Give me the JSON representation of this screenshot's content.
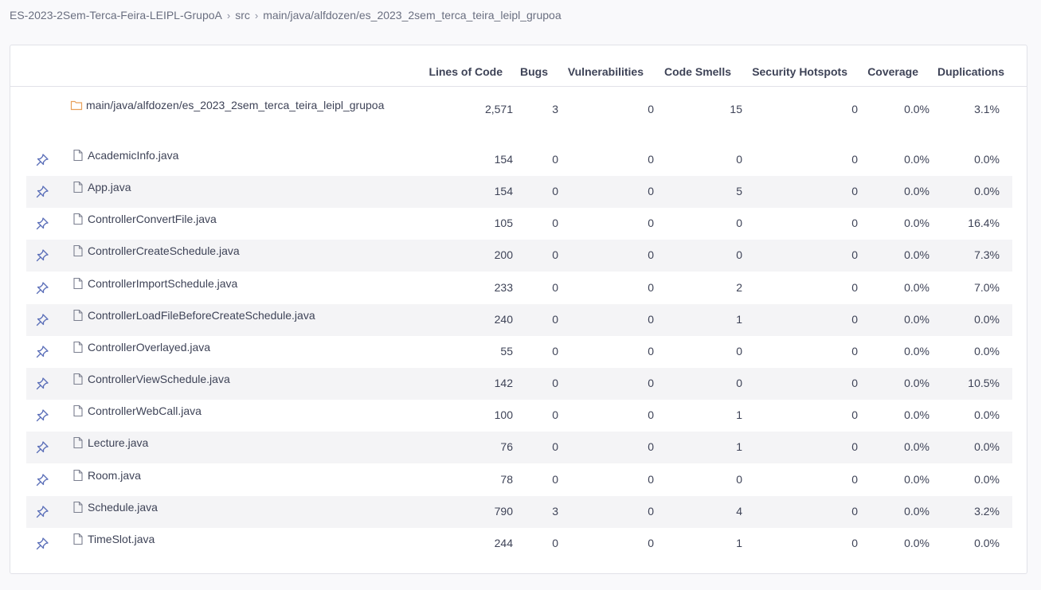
{
  "breadcrumb": {
    "project": "ES-2023-2Sem-Terca-Feira-LEIPL-GrupoA",
    "src": "src",
    "path": "main/java/alfdozen/es_2023_2sem_terca_teira_leipl_grupoa"
  },
  "columns": {
    "loc": "Lines of Code",
    "bugs": "Bugs",
    "vulnerabilities": "Vulnerabilities",
    "code_smells": "Code Smells",
    "security_hotspots": "Security Hotspots",
    "coverage": "Coverage",
    "duplications": "Duplications"
  },
  "directory": {
    "name": "main/java/alfdozen/es_2023_2sem_terca_teira_leipl_grupoa",
    "loc": "2,571",
    "bugs": "3",
    "vulnerabilities": "0",
    "code_smells": "15",
    "security_hotspots": "0",
    "coverage": "0.0%",
    "duplications": "3.1%"
  },
  "files": [
    {
      "name": "AcademicInfo.java",
      "loc": "154",
      "bugs": "0",
      "vulnerabilities": "0",
      "code_smells": "0",
      "security_hotspots": "0",
      "coverage": "0.0%",
      "duplications": "0.0%"
    },
    {
      "name": "App.java",
      "loc": "154",
      "bugs": "0",
      "vulnerabilities": "0",
      "code_smells": "5",
      "security_hotspots": "0",
      "coverage": "0.0%",
      "duplications": "0.0%"
    },
    {
      "name": "ControllerConvertFile.java",
      "loc": "105",
      "bugs": "0",
      "vulnerabilities": "0",
      "code_smells": "0",
      "security_hotspots": "0",
      "coverage": "0.0%",
      "duplications": "16.4%"
    },
    {
      "name": "ControllerCreateSchedule.java",
      "loc": "200",
      "bugs": "0",
      "vulnerabilities": "0",
      "code_smells": "0",
      "security_hotspots": "0",
      "coverage": "0.0%",
      "duplications": "7.3%"
    },
    {
      "name": "ControllerImportSchedule.java",
      "loc": "233",
      "bugs": "0",
      "vulnerabilities": "0",
      "code_smells": "2",
      "security_hotspots": "0",
      "coverage": "0.0%",
      "duplications": "7.0%"
    },
    {
      "name": "ControllerLoadFileBeforeCreateSchedule.java",
      "loc": "240",
      "bugs": "0",
      "vulnerabilities": "0",
      "code_smells": "1",
      "security_hotspots": "0",
      "coverage": "0.0%",
      "duplications": "0.0%"
    },
    {
      "name": "ControllerOverlayed.java",
      "loc": "55",
      "bugs": "0",
      "vulnerabilities": "0",
      "code_smells": "0",
      "security_hotspots": "0",
      "coverage": "0.0%",
      "duplications": "0.0%"
    },
    {
      "name": "ControllerViewSchedule.java",
      "loc": "142",
      "bugs": "0",
      "vulnerabilities": "0",
      "code_smells": "0",
      "security_hotspots": "0",
      "coverage": "0.0%",
      "duplications": "10.5%"
    },
    {
      "name": "ControllerWebCall.java",
      "loc": "100",
      "bugs": "0",
      "vulnerabilities": "0",
      "code_smells": "1",
      "security_hotspots": "0",
      "coverage": "0.0%",
      "duplications": "0.0%"
    },
    {
      "name": "Lecture.java",
      "loc": "76",
      "bugs": "0",
      "vulnerabilities": "0",
      "code_smells": "1",
      "security_hotspots": "0",
      "coverage": "0.0%",
      "duplications": "0.0%"
    },
    {
      "name": "Room.java",
      "loc": "78",
      "bugs": "0",
      "vulnerabilities": "0",
      "code_smells": "0",
      "security_hotspots": "0",
      "coverage": "0.0%",
      "duplications": "0.0%"
    },
    {
      "name": "Schedule.java",
      "loc": "790",
      "bugs": "3",
      "vulnerabilities": "0",
      "code_smells": "4",
      "security_hotspots": "0",
      "coverage": "0.0%",
      "duplications": "3.2%"
    },
    {
      "name": "TimeSlot.java",
      "loc": "244",
      "bugs": "0",
      "vulnerabilities": "0",
      "code_smells": "1",
      "security_hotspots": "0",
      "coverage": "0.0%",
      "duplications": "0.0%"
    }
  ],
  "colors": {
    "folder_icon": "#e8a05a",
    "file_icon": "#7b7f8f",
    "pin_icon": "#5a6eb8",
    "row_alt": "#f4f4f6"
  }
}
